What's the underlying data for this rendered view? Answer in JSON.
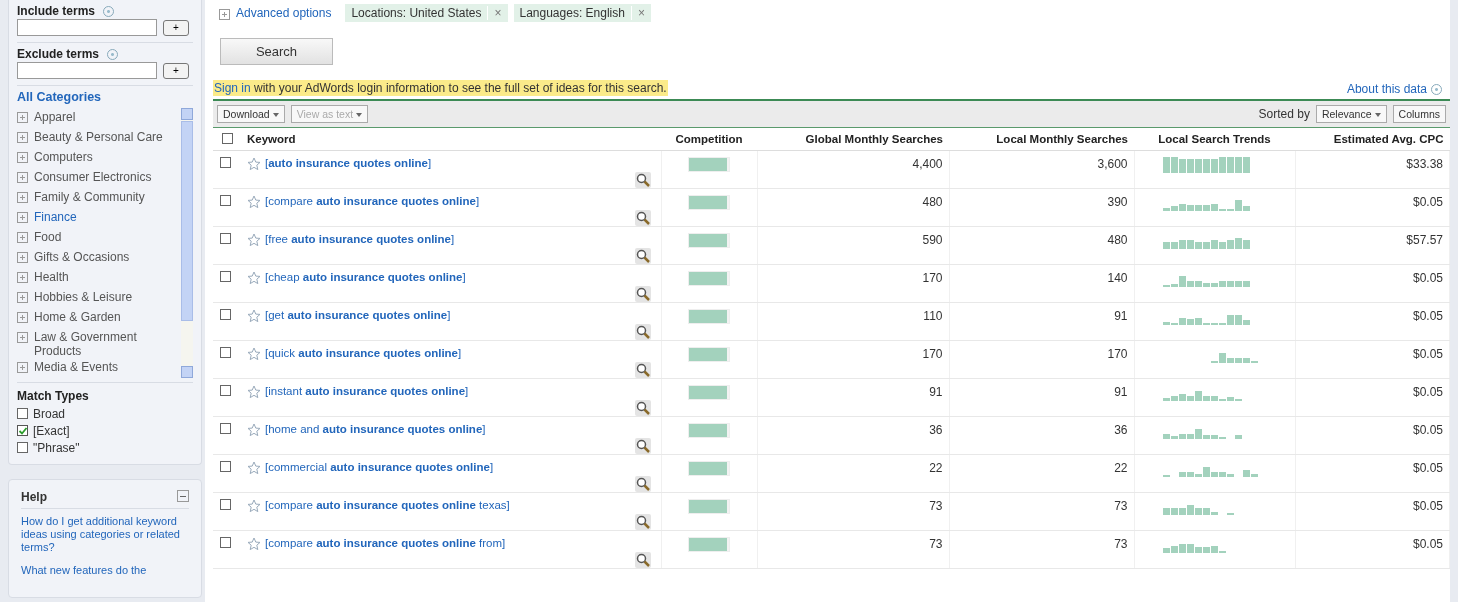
{
  "sidebar": {
    "include": {
      "label": "Include terms",
      "add": "+"
    },
    "exclude": {
      "label": "Exclude terms",
      "add": "+"
    },
    "categories_title": "All Categories",
    "categories": [
      {
        "label": "Apparel",
        "selected": false
      },
      {
        "label": "Beauty & Personal Care",
        "selected": false
      },
      {
        "label": "Computers",
        "selected": false
      },
      {
        "label": "Consumer Electronics",
        "selected": false
      },
      {
        "label": "Family & Community",
        "selected": false
      },
      {
        "label": "Finance",
        "selected": true
      },
      {
        "label": "Food",
        "selected": false
      },
      {
        "label": "Gifts & Occasions",
        "selected": false
      },
      {
        "label": "Health",
        "selected": false
      },
      {
        "label": "Hobbies & Leisure",
        "selected": false
      },
      {
        "label": "Home & Garden",
        "selected": false
      },
      {
        "label": "Law & Government Products",
        "selected": false
      },
      {
        "label": "Media & Events",
        "selected": false
      }
    ],
    "match_types_title": "Match Types",
    "match_types": [
      {
        "label": "Broad",
        "checked": false
      },
      {
        "label": "[Exact]",
        "checked": true
      },
      {
        "label": "\"Phrase\"",
        "checked": false
      }
    ],
    "help": {
      "title": "Help",
      "links": [
        "How do I get additional keyword ideas using categories or related terms?",
        "What new features do the"
      ]
    }
  },
  "options": {
    "advanced": "Advanced options",
    "chips": [
      {
        "label": "Locations: United States",
        "remove": "×"
      },
      {
        "label": "Languages: English",
        "remove": "×"
      }
    ]
  },
  "search_button": "Search",
  "notice": {
    "link": "Sign in",
    "text": "with your AdWords login information to see the full set of ideas for this search."
  },
  "about": "About this data",
  "toolbar": {
    "download": "Download",
    "view_as_text": "View as text",
    "sorted_by": "Sorted by",
    "sort": "Relevance",
    "columns": "Columns"
  },
  "table": {
    "select_all": {
      "checked": false
    },
    "columns": [
      "Keyword",
      "Competition",
      "Global Monthly Searches",
      "Local Monthly Searches",
      "Local Search Trends",
      "Estimated Avg. CPC"
    ],
    "rows": [
      {
        "keyword": "[**auto insurance quotes online**]",
        "competition": {
          "level": 0.95
        },
        "global": "4,400",
        "local": "3,600",
        "cpc": "$33.38",
        "checked": false,
        "starred": false
      },
      {
        "keyword": "[compare **auto insurance quotes online**]",
        "competition": {
          "level": 0.95
        },
        "global": "480",
        "local": "390",
        "cpc": "$0.05",
        "checked": false,
        "starred": false
      },
      {
        "keyword": "[free **auto insurance quotes online**]",
        "competition": {
          "level": 0.95
        },
        "global": "590",
        "local": "480",
        "cpc": "$57.57",
        "checked": false,
        "starred": false
      },
      {
        "keyword": "[cheap **auto insurance quotes online**]",
        "competition": {
          "level": 0.95
        },
        "global": "170",
        "local": "140",
        "cpc": "$0.05",
        "checked": false,
        "starred": false
      },
      {
        "keyword": "[get **auto insurance quotes online**]",
        "competition": {
          "level": 0.95
        },
        "global": "110",
        "local": "91",
        "cpc": "$0.05",
        "checked": false,
        "starred": false
      },
      {
        "keyword": "[quick **auto insurance quotes online**]",
        "competition": {
          "level": 0.95
        },
        "global": "170",
        "local": "170",
        "cpc": "$0.05",
        "checked": false,
        "starred": false
      },
      {
        "keyword": "[instant **auto insurance quotes online**]",
        "competition": {
          "level": 0.95
        },
        "global": "91",
        "local": "91",
        "cpc": "$0.05",
        "checked": false,
        "starred": false
      },
      {
        "keyword": "[home and **auto insurance quotes online**]",
        "competition": {
          "level": 0.95
        },
        "global": "36",
        "local": "36",
        "cpc": "$0.05",
        "checked": false,
        "starred": false
      },
      {
        "keyword": "[commercial **auto insurance quotes online**]",
        "competition": {
          "level": 0.95
        },
        "global": "22",
        "local": "22",
        "cpc": "$0.05",
        "checked": false,
        "starred": false
      },
      {
        "keyword": "[compare **auto insurance quotes online** texas]",
        "competition": {
          "level": 0.95
        },
        "global": "73",
        "local": "73",
        "cpc": "$0.05",
        "checked": false,
        "starred": false
      },
      {
        "keyword": "[compare **auto insurance quotes online** from]",
        "competition": {
          "level": 0.95
        },
        "global": "73",
        "local": "73",
        "cpc": "$0.05",
        "checked": false,
        "starred": false
      }
    ]
  }
}
